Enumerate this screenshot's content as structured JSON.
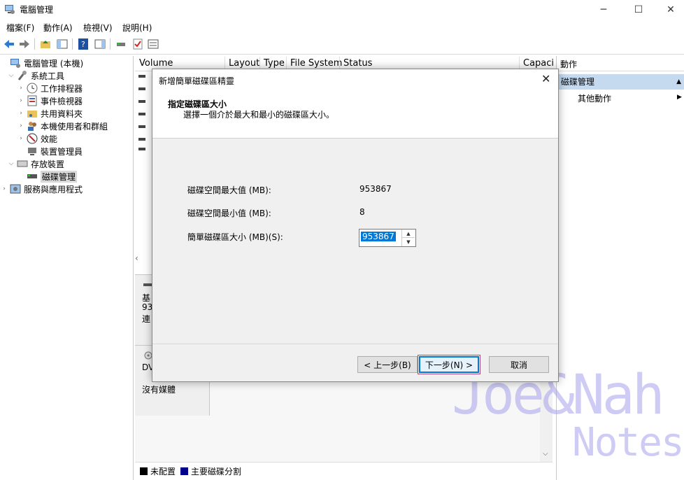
{
  "window": {
    "title": "電腦管理"
  },
  "menu": [
    "檔案(F)",
    "動作(A)",
    "檢視(V)",
    "說明(H)"
  ],
  "tree": {
    "root": "電腦管理 (本機)",
    "system_tools": "系統工具",
    "task_scheduler": "工作排程器",
    "event_viewer": "事件檢視器",
    "shared_folders": "共用資料夾",
    "local_users": "本機使用者和群組",
    "performance": "效能",
    "device_manager": "裝置管理員",
    "storage": "存放裝置",
    "disk_management": "磁碟管理",
    "services": "服務與應用程式"
  },
  "columns": [
    "Volume",
    "Layout",
    "Type",
    "File System",
    "Status",
    "Capaci"
  ],
  "disk_panel": {
    "disk0_a": "基",
    "disk0_b": "93",
    "disk0_c": "連",
    "dvd_label": "DV",
    "dvd_status": "沒有媒體"
  },
  "legend": {
    "unallocated": "未配置",
    "primary": "主要磁碟分割",
    "unallocated_color": "#000000",
    "primary_color": "#00008b"
  },
  "actions": {
    "header": "動作",
    "section": "磁碟管理",
    "more": "其他動作"
  },
  "dialog": {
    "title": "新增簡單磁碟區精靈",
    "heading": "指定磁碟區大小",
    "subtitle": "選擇一個介於最大和最小的磁碟區大小。",
    "max_label": "磁碟空間最大值 (MB):",
    "max_value": "953867",
    "min_label": "磁碟空間最小值 (MB):",
    "min_value": "8",
    "size_label": "簡單磁碟區大小 (MB)(S):",
    "size_value": "953867",
    "back": "< 上一步(B)",
    "next": "下一步(N) >",
    "cancel": "取消"
  },
  "watermark": {
    "line1": "Joe&Nah",
    "line2": "Notes"
  }
}
